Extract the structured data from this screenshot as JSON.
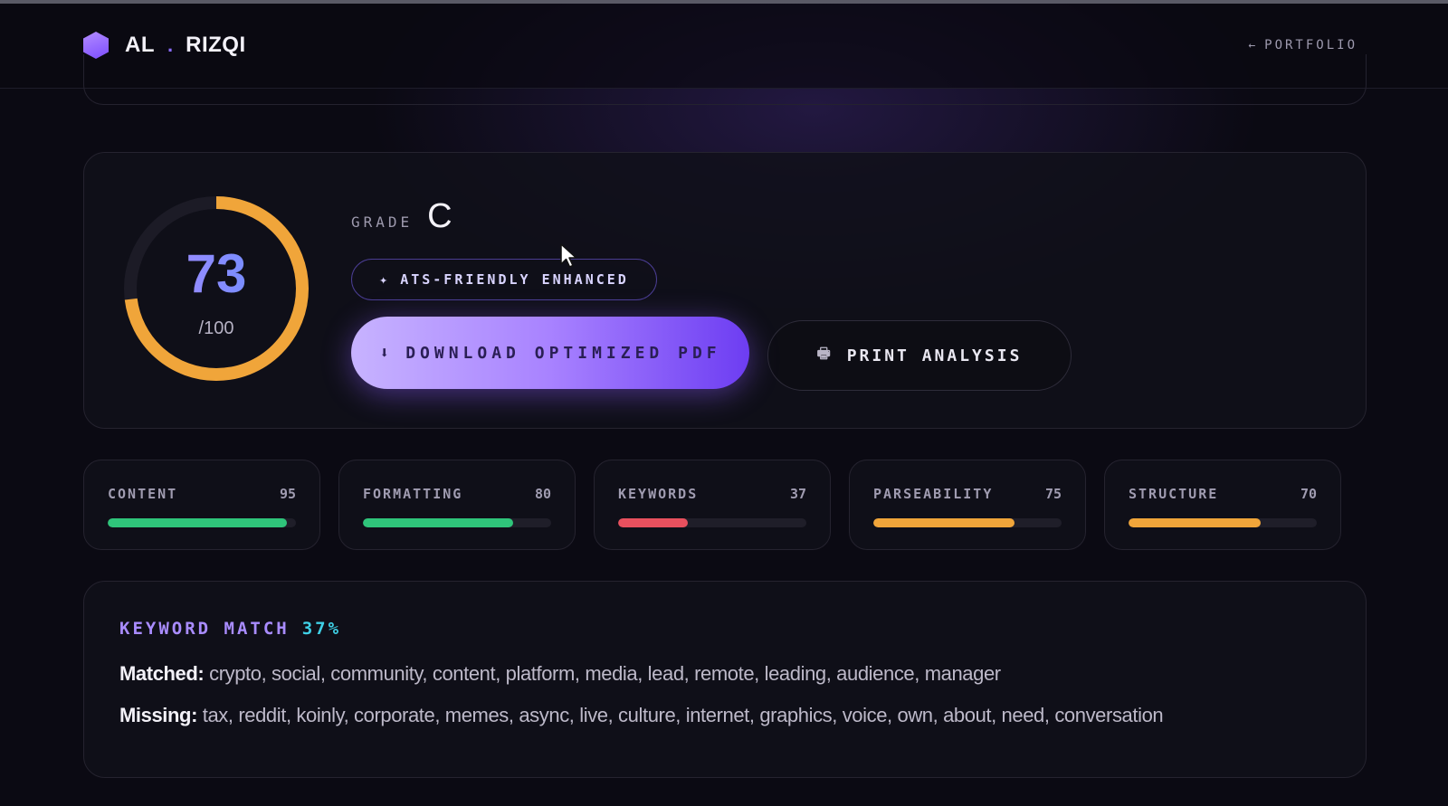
{
  "header": {
    "brand_first": "AL",
    "brand_sep": ".",
    "brand_last": "RIZQI",
    "portfolio_arrow": "←",
    "portfolio_label": "PORTFOLIO"
  },
  "score": {
    "value": "73",
    "max_label": "/100",
    "fraction": 0.73,
    "grade_label": "GRADE",
    "grade": "C",
    "gauge_color": "#f0a53a"
  },
  "badge": {
    "icon": "✦",
    "label": "ATS-FRIENDLY ENHANCED"
  },
  "actions": {
    "download_icon": "⬇",
    "download_label": "DOWNLOAD OPTIMIZED PDF",
    "print_icon": "🖶",
    "print_label": "PRINT ANALYSIS"
  },
  "metrics": [
    {
      "label": "CONTENT",
      "value": 95,
      "color": "#2fc47a"
    },
    {
      "label": "FORMATTING",
      "value": 80,
      "color": "#2fc47a"
    },
    {
      "label": "KEYWORDS",
      "value": 37,
      "color": "#e8505e"
    },
    {
      "label": "PARSEABILITY",
      "value": 75,
      "color": "#f0a53a"
    },
    {
      "label": "STRUCTURE",
      "value": 70,
      "color": "#f0a53a"
    }
  ],
  "keywords": {
    "title": "KEYWORD MATCH",
    "percent": "37%",
    "matched_label": "Matched:",
    "matched": "crypto, social, community, content, platform, media, lead, remote, leading, audience, manager",
    "missing_label": "Missing:",
    "missing": "tax, reddit, koinly, corporate, memes, async, live, culture, internet, graphics, voice, own, about, need, conversation"
  }
}
